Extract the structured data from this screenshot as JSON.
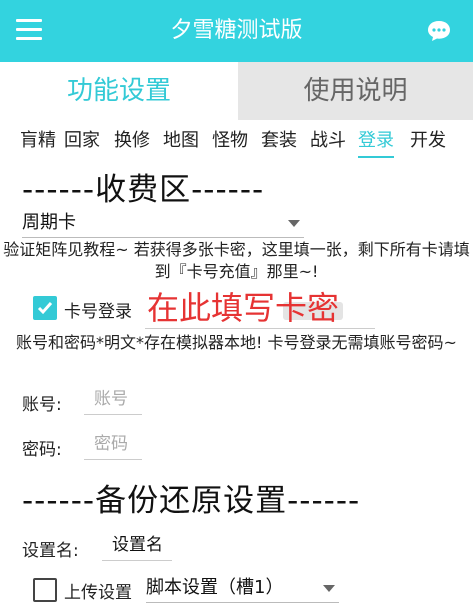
{
  "header": {
    "app_title": "夕雪糖测试版",
    "menu_icon": "hamburger-menu-icon",
    "chat_icon": "chat-bubble-icon",
    "bar_color": "#33d3df"
  },
  "tabs": [
    {
      "label": "功能设置",
      "active": true
    },
    {
      "label": "使用说明",
      "active": false
    }
  ],
  "subtabs": [
    "肓精",
    "回家",
    "换修",
    "地图",
    "怪物",
    "套装",
    "战斗",
    "登录",
    "开发"
  ],
  "active_subtab": "登录",
  "charge_section": {
    "title": "------收费区------",
    "card_type": "周期卡",
    "info_text": "验证矩阵见教程~ 若获得多张卡密，这里填一张，剩下所有卡请填到『卡号充值』那里~!",
    "card_login_label": "卡号登录",
    "card_login_checked": true,
    "overlay_hint": "在此填写卡密",
    "account_note": "账号和密码*明文*存在模拟器本地! 卡号登录无需填账号密码~",
    "account_label": "账号:",
    "account_placeholder": "账号",
    "password_label": "密码:",
    "password_placeholder": "密码"
  },
  "backup_section": {
    "title": "------备份还原设置------",
    "name_label": "设置名:",
    "name_value": "设置名",
    "upload_label": "上传设置",
    "upload_checked": false,
    "slot_value": "脚本设置（槽1）"
  },
  "colors": {
    "accent": "#33cad6",
    "overlay_red": "#e63333"
  }
}
